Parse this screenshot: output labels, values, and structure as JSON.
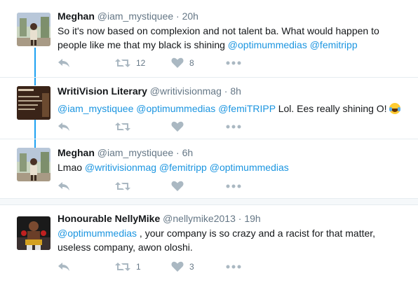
{
  "tweets": [
    {
      "fullname": "Meghan",
      "username": "@iam_mystiquee",
      "time": "20h",
      "text_before": "So it's now based on complexion and not talent ba. What would happen to people like me that my black is shining",
      "mentions": [
        "@optimummedias",
        "@femitripp"
      ],
      "text_after": "",
      "retweets": "12",
      "likes": "8"
    },
    {
      "fullname": "WritiVision Literary",
      "username": "@writivisionmag",
      "time": "8h",
      "mentions": [
        "@iam_mystiquee",
        "@optimummedias",
        "@femiTRIPP"
      ],
      "text_after": "Lol. Ees really shining O!",
      "emoji": "face-with-tears-of-joy",
      "retweets": "",
      "likes": ""
    },
    {
      "fullname": "Meghan",
      "username": "@iam_mystiquee",
      "time": "6h",
      "text_before": "Lmao",
      "mentions": [
        "@writivisionmag",
        "@femitripp",
        "@optimummedias"
      ],
      "retweets": "",
      "likes": ""
    },
    {
      "fullname": "Honourable NellyMike",
      "username": "@nellymike2013",
      "time": "19h",
      "mentions": [
        "@optimummedias"
      ],
      "text_after": ", your company is so crazy and a racist for that matter, useless company, awon oloshi.",
      "retweets": "1",
      "likes": "3"
    }
  ],
  "separator": "·",
  "colors": {
    "link": "#1b95e0",
    "thread": "#1da1f2",
    "muted": "#657786",
    "icon": "#aab8c2"
  }
}
